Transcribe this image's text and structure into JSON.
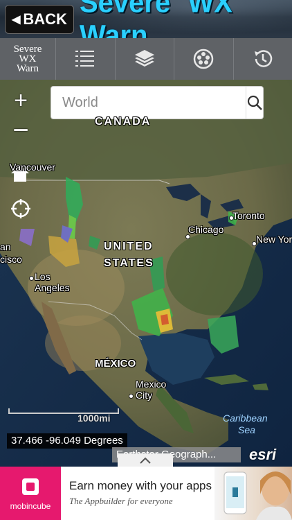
{
  "header": {
    "back_label": "BACK",
    "back_arrow": "◀",
    "title": "Severe WX Warn"
  },
  "toolbar": {
    "logo_lines": [
      "Severe",
      "WX",
      "Warn"
    ],
    "buttons": [
      {
        "name": "list-icon"
      },
      {
        "name": "layers-icon"
      },
      {
        "name": "filmstrip-icon"
      },
      {
        "name": "history-icon"
      }
    ]
  },
  "map": {
    "zoom_in": "+",
    "zoom_out": "−",
    "search": {
      "placeholder": "World"
    },
    "labels": {
      "canada": "CANADA",
      "vancouver": "Vancouver",
      "toronto": "Toronto",
      "chicago": "Chicago",
      "new_york": "New York",
      "united": "UNITED",
      "states": "STATES",
      "san_francisco": "an\ncisco",
      "los": "Los",
      "angeles": "Angeles",
      "mexico": "MÉXICO",
      "mexico_city_1": "Mexico",
      "mexico_city_2": "City",
      "caribbean": "Caribbean",
      "sea": "Sea"
    },
    "scale_label": "1000mi",
    "coord_readout": "37.466 -96.049 Degrees",
    "attribution": "Earthstar Geograph...",
    "logo": "esri"
  },
  "ad": {
    "brand": "mobincube",
    "headline": "Earn money with your apps",
    "subline": "The Appbuilder for everyone"
  },
  "colors": {
    "title_blue": "#2ad0ff",
    "toolbar_gray": "#5f6266",
    "ad_pink": "#e6196e"
  }
}
